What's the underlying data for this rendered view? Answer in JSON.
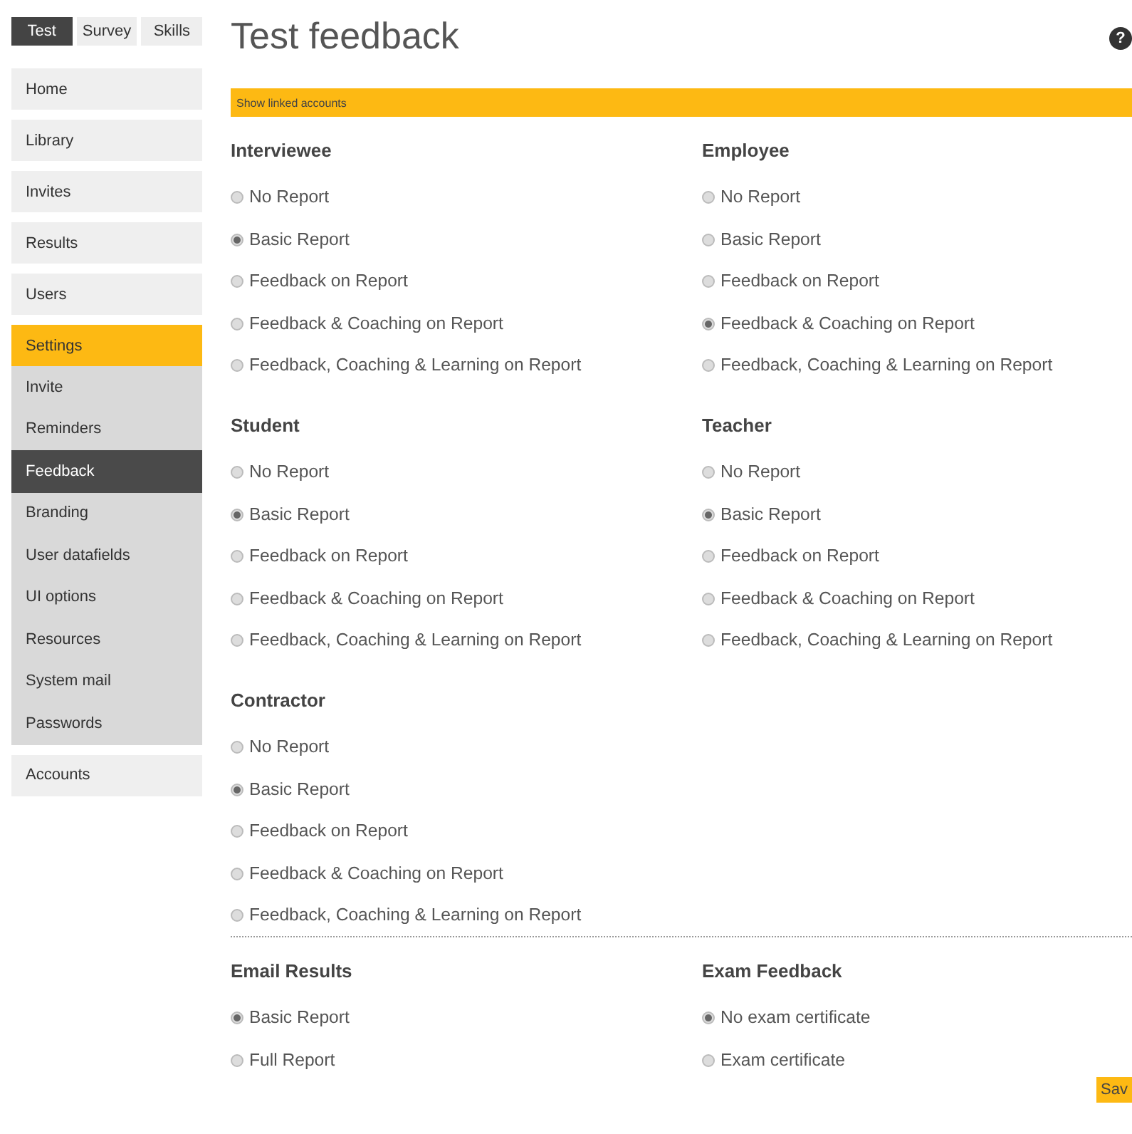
{
  "top_tabs": [
    {
      "label": "Test",
      "selected": true
    },
    {
      "label": "Survey",
      "selected": false
    },
    {
      "label": "Skills",
      "selected": false
    }
  ],
  "sidebar": {
    "items": [
      {
        "label": "Home",
        "selected": false
      },
      {
        "label": "Library",
        "selected": false
      },
      {
        "label": "Invites",
        "selected": false
      },
      {
        "label": "Results",
        "selected": false
      },
      {
        "label": "Users",
        "selected": false
      },
      {
        "label": "Settings",
        "selected": true,
        "children": [
          {
            "label": "Invite",
            "selected": false
          },
          {
            "label": "Reminders",
            "selected": false
          },
          {
            "label": "Feedback",
            "selected": true
          },
          {
            "label": "Branding",
            "selected": false
          },
          {
            "label": "User datafields",
            "selected": false
          },
          {
            "label": "UI options",
            "selected": false
          },
          {
            "label": "Resources",
            "selected": false
          },
          {
            "label": "System mail",
            "selected": false
          },
          {
            "label": "Passwords",
            "selected": false
          }
        ]
      },
      {
        "label": "Accounts",
        "selected": false
      }
    ]
  },
  "page_title": "Test feedback",
  "help_icon": "?",
  "linked_bar": "Show linked accounts",
  "groups": [
    {
      "title": "Interviewee",
      "options": [
        {
          "label": "No Report",
          "selected": false
        },
        {
          "label": "Basic Report",
          "selected": true
        },
        {
          "label": "Feedback on Report",
          "selected": false
        },
        {
          "label": "Feedback & Coaching on Report",
          "selected": false
        },
        {
          "label": "Feedback, Coaching & Learning on Report",
          "selected": false
        }
      ]
    },
    {
      "title": "Employee",
      "options": [
        {
          "label": "No Report",
          "selected": false
        },
        {
          "label": "Basic Report",
          "selected": false
        },
        {
          "label": "Feedback on Report",
          "selected": false
        },
        {
          "label": "Feedback & Coaching on Report",
          "selected": true
        },
        {
          "label": "Feedback, Coaching & Learning on Report",
          "selected": false
        }
      ]
    },
    {
      "title": "Student",
      "options": [
        {
          "label": "No Report",
          "selected": false
        },
        {
          "label": "Basic Report",
          "selected": true
        },
        {
          "label": "Feedback on Report",
          "selected": false
        },
        {
          "label": "Feedback & Coaching on Report",
          "selected": false
        },
        {
          "label": "Feedback, Coaching & Learning on Report",
          "selected": false
        }
      ]
    },
    {
      "title": "Teacher",
      "options": [
        {
          "label": "No Report",
          "selected": false
        },
        {
          "label": "Basic Report",
          "selected": true
        },
        {
          "label": "Feedback on Report",
          "selected": false
        },
        {
          "label": "Feedback & Coaching on Report",
          "selected": false
        },
        {
          "label": "Feedback, Coaching & Learning on Report",
          "selected": false
        }
      ]
    },
    {
      "title": "Contractor",
      "options": [
        {
          "label": "No Report",
          "selected": false
        },
        {
          "label": "Basic Report",
          "selected": true
        },
        {
          "label": "Feedback on Report",
          "selected": false
        },
        {
          "label": "Feedback & Coaching on Report",
          "selected": false
        },
        {
          "label": "Feedback, Coaching & Learning on Report",
          "selected": false
        }
      ]
    }
  ],
  "bottom_groups": [
    {
      "title": "Email Results",
      "options": [
        {
          "label": "Basic Report",
          "selected": true
        },
        {
          "label": "Full Report",
          "selected": false
        }
      ]
    },
    {
      "title": "Exam Feedback",
      "options": [
        {
          "label": "No exam certificate",
          "selected": true
        },
        {
          "label": "Exam certificate",
          "selected": false
        }
      ]
    }
  ],
  "save_button": "Sav"
}
